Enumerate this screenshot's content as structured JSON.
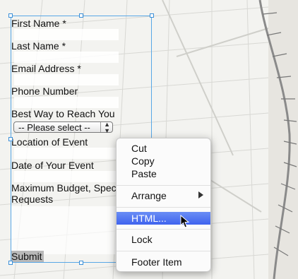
{
  "form": {
    "fields": [
      {
        "label": "First Name *"
      },
      {
        "label": "Last Name *"
      },
      {
        "label": "Email Address *"
      },
      {
        "label": "Phone Number"
      },
      {
        "label": "Best Way to Reach You"
      },
      {
        "label": "Location of Event"
      },
      {
        "label": "Date of Your Event"
      },
      {
        "label": "Maximum Budget, Spec"
      },
      {
        "label": "Requests"
      }
    ],
    "select_value": "-- Please select --",
    "submit_label": "Submit"
  },
  "context_menu": {
    "items": [
      "Cut",
      "Copy",
      "Paste",
      "Arrange",
      "HTML...",
      "Lock",
      "Footer Item"
    ],
    "highlighted": "HTML..."
  },
  "colors": {
    "selection": "#58a7e6",
    "highlight": "#4a6ff0"
  }
}
